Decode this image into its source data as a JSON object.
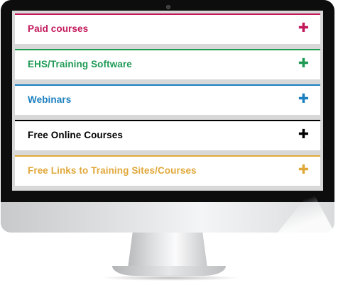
{
  "accordion": {
    "items": [
      {
        "label": "Paid courses",
        "icon": "plus-icon",
        "color": "#c2185b"
      },
      {
        "label": "EHS/Training Software",
        "icon": "plus-icon",
        "color": "#1f9a55"
      },
      {
        "label": "Webinars",
        "icon": "plus-icon",
        "color": "#1b7fc0"
      },
      {
        "label": "Free Online Courses",
        "icon": "plus-icon",
        "color": "#000000"
      },
      {
        "label": "Free Links to Training Sites/Courses",
        "icon": "plus-icon",
        "color": "#e0a83a"
      }
    ]
  },
  "plus_glyph": "✚"
}
